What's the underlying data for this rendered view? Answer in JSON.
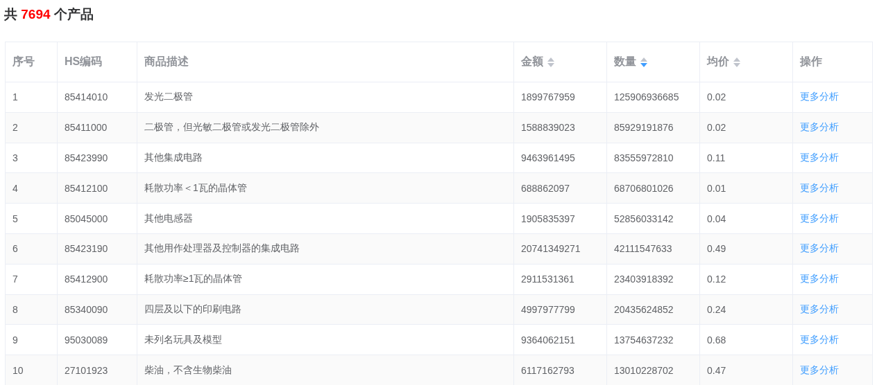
{
  "summary": {
    "prefix": "共",
    "count": "7694",
    "suffix": "个产品"
  },
  "table": {
    "columns": [
      {
        "label": "序号"
      },
      {
        "label": "HS编码"
      },
      {
        "label": "商品描述"
      },
      {
        "label": "金额",
        "sort_asc": false,
        "sort_desc": false
      },
      {
        "label": "数量",
        "sort_asc": false,
        "sort_desc": true
      },
      {
        "label": "均价",
        "sort_asc": false,
        "sort_desc": false
      },
      {
        "label": "操作"
      }
    ],
    "rows": [
      {
        "index": "1",
        "hs_code": "85414010",
        "description": "发光二极管",
        "amount": "1899767959",
        "quantity": "125906936685",
        "avg_price": "0.02",
        "action": "更多分析"
      },
      {
        "index": "2",
        "hs_code": "85411000",
        "description": "二极管，但光敏二极管或发光二极管除外",
        "amount": "1588839023",
        "quantity": "85929191876",
        "avg_price": "0.02",
        "action": "更多分析"
      },
      {
        "index": "3",
        "hs_code": "85423990",
        "description": "其他集成电路",
        "amount": "9463961495",
        "quantity": "83555972810",
        "avg_price": "0.11",
        "action": "更多分析"
      },
      {
        "index": "4",
        "hs_code": "85412100",
        "description": "耗散功率＜1瓦的晶体管",
        "amount": "688862097",
        "quantity": "68706801026",
        "avg_price": "0.01",
        "action": "更多分析"
      },
      {
        "index": "5",
        "hs_code": "85045000",
        "description": "其他电感器",
        "amount": "1905835397",
        "quantity": "52856033142",
        "avg_price": "0.04",
        "action": "更多分析"
      },
      {
        "index": "6",
        "hs_code": "85423190",
        "description": "其他用作处理器及控制器的集成电路",
        "amount": "20741349271",
        "quantity": "42111547633",
        "avg_price": "0.49",
        "action": "更多分析"
      },
      {
        "index": "7",
        "hs_code": "85412900",
        "description": "耗散功率≥1瓦的晶体管",
        "amount": "2911531361",
        "quantity": "23403918392",
        "avg_price": "0.12",
        "action": "更多分析"
      },
      {
        "index": "8",
        "hs_code": "85340090",
        "description": "四层及以下的印刷电路",
        "amount": "4997977799",
        "quantity": "20435624852",
        "avg_price": "0.24",
        "action": "更多分析"
      },
      {
        "index": "9",
        "hs_code": "95030089",
        "description": "未列名玩具及模型",
        "amount": "9364062151",
        "quantity": "13754637232",
        "avg_price": "0.68",
        "action": "更多分析"
      },
      {
        "index": "10",
        "hs_code": "27101923",
        "description": "柴油，不含生物柴油",
        "amount": "6117162793",
        "quantity": "13010228702",
        "avg_price": "0.47",
        "action": "更多分析"
      }
    ]
  }
}
